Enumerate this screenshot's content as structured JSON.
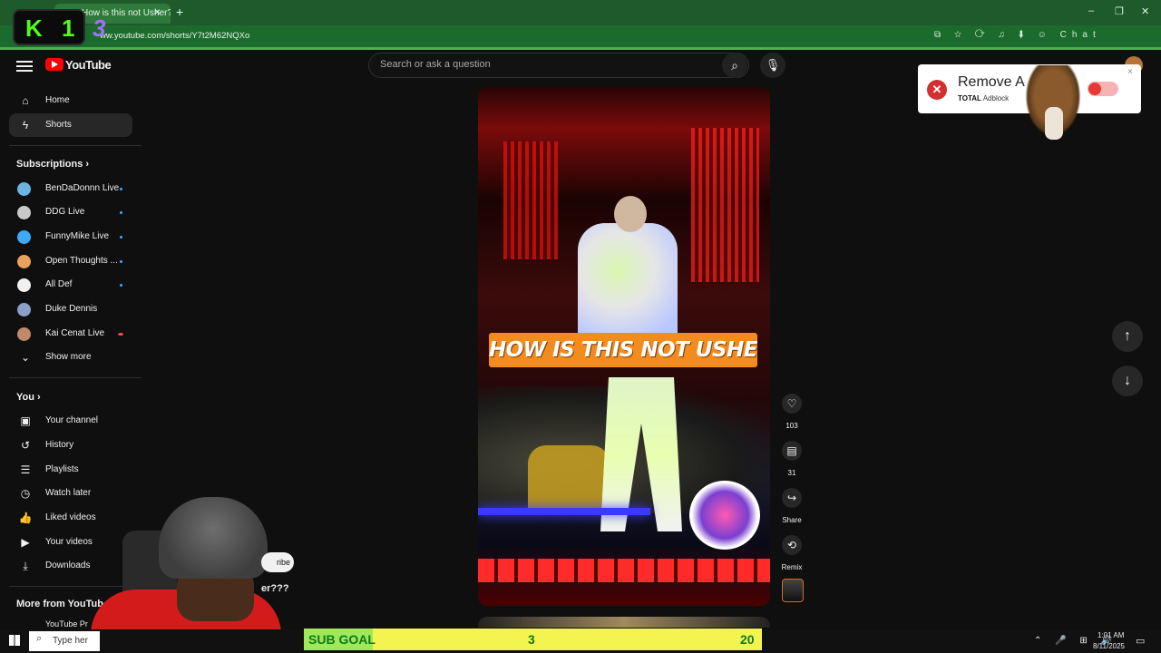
{
  "browser": {
    "tab_title": "How is this not Usher??",
    "tab_close": "×",
    "new_tab": "+",
    "url": "ww.youtube.com/shorts/Y7t2M62NQXo",
    "window_controls": [
      "–",
      "❐",
      "✕"
    ],
    "ext_icons": "⧉ ☆ ⟳ ♫ ⬇ ☺ Chat"
  },
  "overlay": {
    "kick_letter": "K",
    "kick_count": "1",
    "twitch_count": "3"
  },
  "youtube": {
    "logo_text": "YouTube",
    "search_placeholder": "Search or ask a question"
  },
  "sidebar": {
    "main": [
      {
        "label": "Home",
        "icon": "home-icon",
        "glyph": "⌂"
      },
      {
        "label": "Shorts",
        "icon": "shorts-icon",
        "glyph": "ϟ"
      }
    ],
    "subscriptions_title": "Subscriptions",
    "subscriptions": [
      {
        "label": "BenDaDonnn Live",
        "color": "#6bb3e0"
      },
      {
        "label": "DDG Live",
        "color": "#c9c9c9"
      },
      {
        "label": "FunnyMike Live",
        "color": "#3fa9f5"
      },
      {
        "label": "Open Thoughts ...",
        "color": "#e8a25c"
      },
      {
        "label": "All Def",
        "color": "#f1f1f1"
      },
      {
        "label": "Duke Dennis",
        "color": "#8aa0c8"
      },
      {
        "label": "Kai Cenat Live",
        "color": "#c08a6a"
      }
    ],
    "show_more": "Show more",
    "you_title": "You",
    "you": [
      {
        "label": "Your channel",
        "glyph": "▣"
      },
      {
        "label": "History",
        "glyph": "↺"
      },
      {
        "label": "Playlists",
        "glyph": "☰"
      },
      {
        "label": "Watch later",
        "glyph": "◷"
      },
      {
        "label": "Liked videos",
        "glyph": "👍"
      },
      {
        "label": "Your videos",
        "glyph": "▶"
      },
      {
        "label": "Downloads",
        "glyph": "⤓"
      }
    ],
    "more_title": "More from YouTub",
    "more_first": "YouTube Pr"
  },
  "short": {
    "caption": "HOW IS THIS NOT USHER???",
    "subscribe_fragment": "ribe",
    "title_fragment": "er???"
  },
  "actions": {
    "like_count": "103",
    "comment_count": "31",
    "share_label": "Share",
    "remix_label": "Remix"
  },
  "popup": {
    "title": "Remove A",
    "brand_bold": "TOTAL",
    "brand_rest": "Adblock",
    "close": "×"
  },
  "taskbar": {
    "search_text": "Type her",
    "subgoal_label": "SUB GOAL",
    "subgoal_current": "3",
    "subgoal_target": "20",
    "clock_time": "1:01 AM",
    "clock_date": "8/11/2025",
    "systray": "⌃ 🎤 ⊞ 🔊"
  },
  "colors": {
    "youtube_red": "#ff0000",
    "browser_green": "#1e5a2a",
    "caption_orange": "#f28c1f",
    "subgoal_yellow": "#f4f450"
  }
}
